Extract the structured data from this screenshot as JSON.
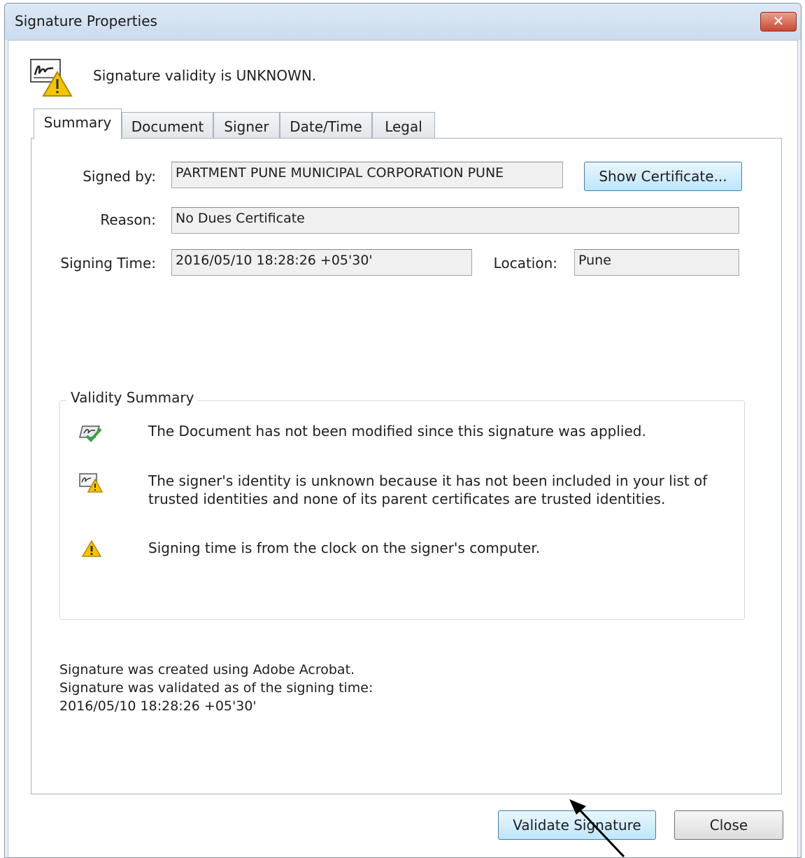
{
  "window": {
    "title": "Signature Properties"
  },
  "header": {
    "status_text": "Signature validity is UNKNOWN."
  },
  "tabs": [
    {
      "label": "Summary"
    },
    {
      "label": "Document"
    },
    {
      "label": "Signer"
    },
    {
      "label": "Date/Time"
    },
    {
      "label": "Legal"
    }
  ],
  "summary": {
    "signed_by_label": "Signed by:",
    "signed_by_value": "PARTMENT PUNE MUNICIPAL CORPORATION PUNE",
    "show_certificate_label": "Show Certificate...",
    "reason_label": "Reason:",
    "reason_value": "No Dues Certificate",
    "signing_time_label": "Signing Time:",
    "signing_time_value": "2016/05/10 18:28:26 +05'30'",
    "location_label": "Location:",
    "location_value": "Pune"
  },
  "validity": {
    "title": "Validity Summary",
    "items": [
      {
        "icon": "document-unmodified-icon",
        "text": "The Document has not been modified since this signature was applied."
      },
      {
        "icon": "unknown-identity-icon",
        "text": "The signer's identity is unknown because it has not been included in your list of trusted identities and none of its parent certificates are trusted identities."
      },
      {
        "icon": "warning-icon",
        "text": "Signing time is from the clock on the signer's computer."
      }
    ]
  },
  "footer": {
    "line1": "Signature was created using Adobe Acrobat.",
    "line2": "Signature was validated as of the signing time:",
    "line3": "2016/05/10 18:28:26 +05'30'"
  },
  "buttons": {
    "validate_label": "Validate Signature",
    "close_label": "Close"
  },
  "colors": {
    "warning_yellow": "#f5c400",
    "check_green": "#3aa341",
    "title_close_red": "#c74a32",
    "focus_blue": "#3c7fb1"
  }
}
